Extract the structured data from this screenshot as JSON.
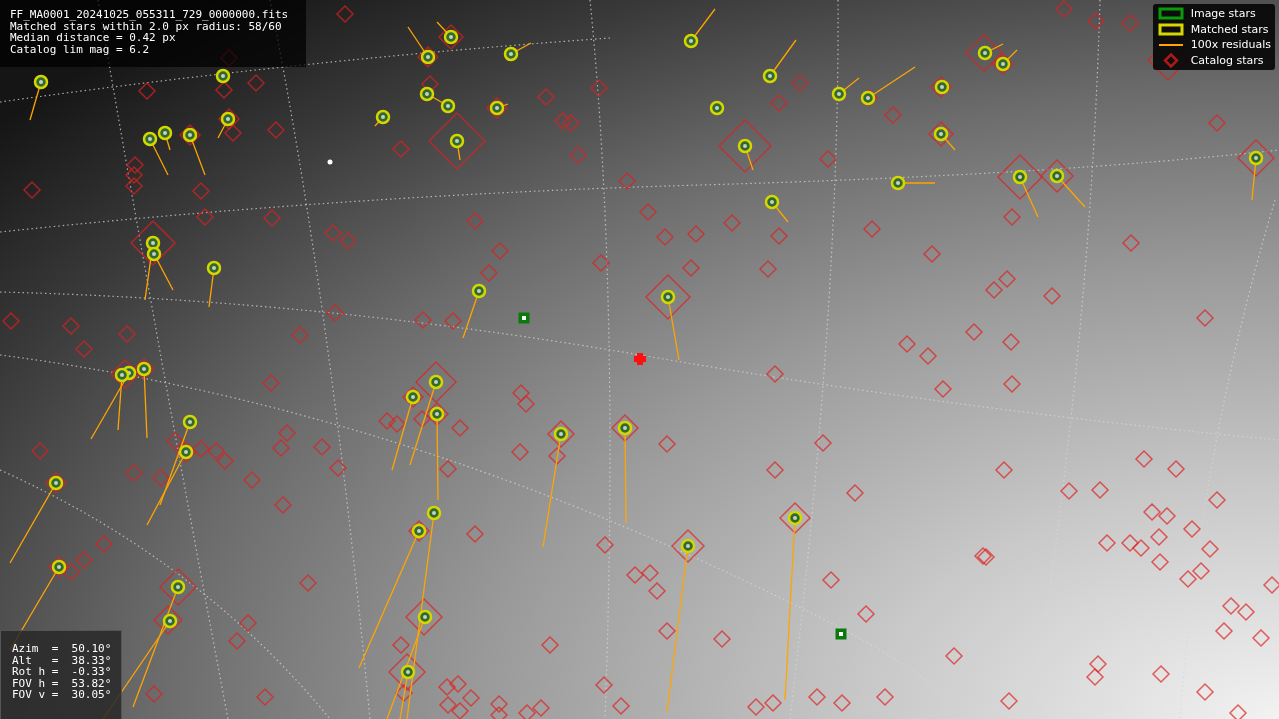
{
  "info_box": {
    "lines": [
      "FF_MA0001_20241025_055311_729_0000000.fits",
      "Matched stars within 2.0 px radius: 58/60",
      "Median distance = 0.42 px",
      "Catalog lim mag = 6.2"
    ]
  },
  "legend": {
    "items": [
      {
        "label": "Image stars",
        "kind": "box",
        "color": "#0a9a0a"
      },
      {
        "label": "Matched stars",
        "kind": "box",
        "color": "#d6d600"
      },
      {
        "label": "100x residuals",
        "kind": "line",
        "color": "#ffa500"
      },
      {
        "label": "Catalog stars",
        "kind": "diamond",
        "color": "#b01818"
      }
    ]
  },
  "pointing_box": {
    "lines": [
      "Azim  =  50.10°",
      "Alt   =  38.33°",
      "Rot h =  -0.33°",
      "FOV h =  53.82°",
      "FOV v =  30.05°"
    ]
  }
}
